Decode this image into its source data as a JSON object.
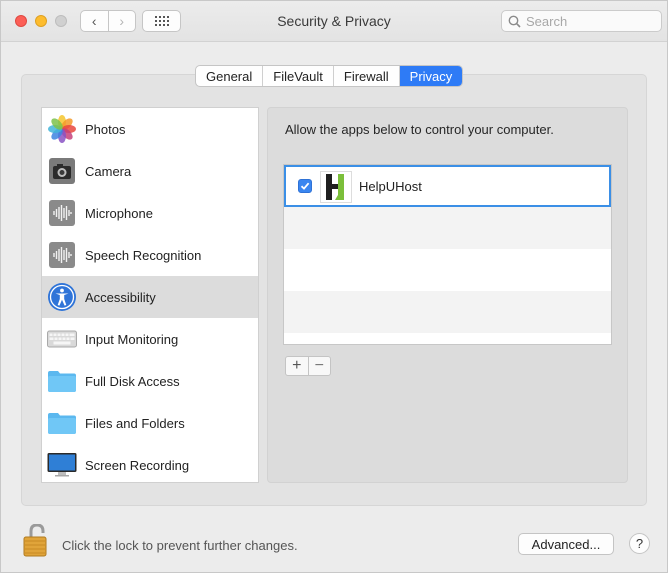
{
  "window": {
    "title": "Security & Privacy"
  },
  "toolbar": {
    "back_glyph": "‹",
    "forward_glyph": "›",
    "search_placeholder": "Search"
  },
  "tabs": [
    {
      "label": "General",
      "active": false
    },
    {
      "label": "FileVault",
      "active": false
    },
    {
      "label": "Firewall",
      "active": false
    },
    {
      "label": "Privacy",
      "active": true
    }
  ],
  "sidebar": {
    "items": [
      {
        "label": "Photos",
        "icon": "photos-icon",
        "selected": false
      },
      {
        "label": "Camera",
        "icon": "camera-icon",
        "selected": false
      },
      {
        "label": "Microphone",
        "icon": "microphone-icon",
        "selected": false
      },
      {
        "label": "Speech Recognition",
        "icon": "speech-recognition-icon",
        "selected": false
      },
      {
        "label": "Accessibility",
        "icon": "accessibility-icon",
        "selected": true
      },
      {
        "label": "Input Monitoring",
        "icon": "keyboard-icon",
        "selected": false
      },
      {
        "label": "Full Disk Access",
        "icon": "folder-icon",
        "selected": false
      },
      {
        "label": "Files and Folders",
        "icon": "folder-icon",
        "selected": false
      },
      {
        "label": "Screen Recording",
        "icon": "display-icon",
        "selected": false
      }
    ]
  },
  "main": {
    "instruction": "Allow the apps below to control your computer.",
    "apps": [
      {
        "name": "HelpUHost",
        "checked": true,
        "icon": "helpuhost-app-icon"
      }
    ],
    "add_label": "+",
    "remove_label": "−"
  },
  "footer": {
    "lock_text": "Click the lock to prevent further changes.",
    "advanced_label": "Advanced...",
    "help_label": "?"
  },
  "colors": {
    "accent": "#2e7bf6",
    "selection_border": "#3b8fe6",
    "close": "#fc5f57",
    "minimize": "#fdbc2e"
  }
}
